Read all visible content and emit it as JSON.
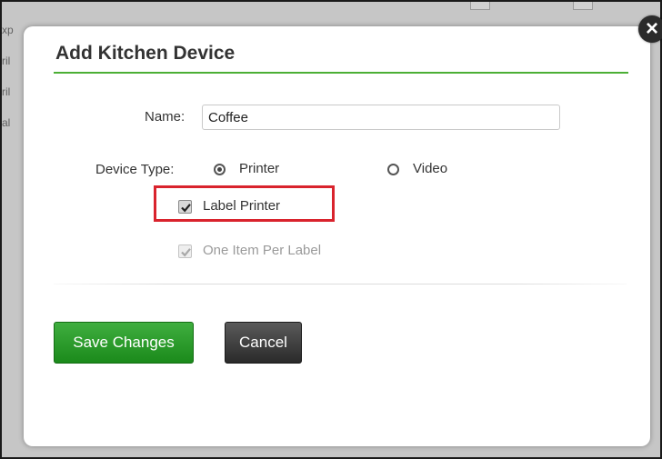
{
  "background": {
    "rows": [
      "xp",
      "ril",
      "ril",
      "al"
    ]
  },
  "modal": {
    "title": "Add Kitchen Device",
    "close_glyph": "×",
    "name_label": "Name:",
    "name_value": "Coffee",
    "device_type_label": "Device Type:",
    "device_type_options": [
      {
        "label": "Printer",
        "selected": true
      },
      {
        "label": "Video",
        "selected": false
      }
    ],
    "label_printer": {
      "label": "Label Printer",
      "checked": true
    },
    "one_item_per_label": {
      "label": "One Item Per Label",
      "checked": true,
      "disabled": true
    },
    "save_label": "Save Changes",
    "cancel_label": "Cancel"
  },
  "colors": {
    "accent_green": "#4caf35",
    "save_button": "#1b8a1b",
    "cancel_button": "#2a2a2a",
    "highlight_red": "#d9232d"
  }
}
